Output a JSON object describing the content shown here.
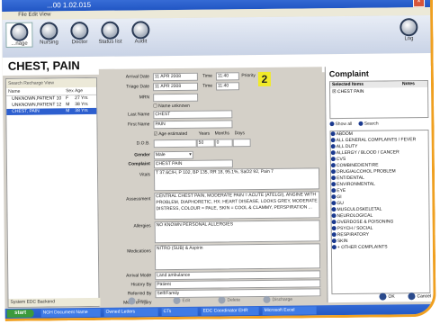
{
  "window": {
    "title": "...00 1.02.015"
  },
  "toolbar": {
    "buttons": [
      "...nage",
      "Nursing",
      "Doctor",
      "Status list",
      "Audit"
    ],
    "logout": "Log"
  },
  "page_title": "CHEST, PAIN",
  "patient_list": {
    "toolbar": "Search   Recharge   View",
    "headers": [
      "Name",
      "Sex",
      "Age"
    ],
    "rows": [
      {
        "name": "UNKNOWN,PATIENT 10",
        "sex": "F",
        "age": "27 Yrs"
      },
      {
        "name": "UNKNOWN,PATIENT 12",
        "sex": "M",
        "age": "38 Yrs"
      },
      {
        "name": "CHEST, PAIN",
        "sex": "M",
        "age": "38 Yrs"
      }
    ],
    "status": "System EDC Backend"
  },
  "form": {
    "arrival_date_label": "Arrival Date",
    "arrival_date": "11 APR 2008",
    "triage_date_label": "Triage Date",
    "triage_date": "11 APR 2008",
    "time_label": "Time",
    "time": "11:40",
    "time2_label": "Time",
    "time2": "11:40",
    "priority_label": "Priority",
    "priority": "2",
    "mrn_label": "MRN",
    "name_unknown": "Name unknown",
    "last_name_label": "Last Name",
    "last_name": "CHEST",
    "first_name_label": "First Name",
    "first_name": "PAIN",
    "age_estimated": "Age estimated",
    "years_label": "Years",
    "months_label": "Months",
    "days_label": "Days",
    "dob_label": "D.O.B.",
    "years": "50",
    "months": "0",
    "gender_label": "Gender",
    "gender": "Male",
    "complaint_label": "Complaint",
    "complaint": "CHEST PAIN",
    "vitals_label": "Vitals",
    "vitals": "T 37.6C/H, P 102, BP 135, RR 18, 95.1%, SaO2 92, Pain 7",
    "assessment_label": "Assessment",
    "assessment": "CENTRAL CHEST PAIN, MODERATE PAIN = ACUTE (ATELGI), ANGINE WITH PROBLEM, DIAPHORETIC, HX: HEART DISEASE, LOOKS GREY, MODERATE DISTRESS, COLOUR = PALE, SKIN = COOL & CLAMMY, PERSPIRATION ...",
    "allergies_label": "Allergies",
    "allergies": "NO KNOWN PERSONAL ALLERGIES",
    "medications_label": "Medications",
    "medications": "NITRO (SUB) & Aspirin",
    "arrival_mode_label": "Arrival Mode",
    "arrival_mode": "Land ambulance",
    "history_label": "History By",
    "history": "Patient",
    "referred_label": "Referred By",
    "referred": "Self/Family",
    "mech_label": "Mech of Injury",
    "mech": ""
  },
  "complaint_panel": {
    "title": "Complaint",
    "selected_header": "Selected Items",
    "notes_header": "Notes",
    "selected_item": "CHEST PAIN",
    "show_all": "Show all",
    "search": "Search",
    "items": [
      "ABDOM",
      "ALL GENERAL COMPLAINTS / FEVER",
      "ALL DUTY",
      "ALLERGY / BLOOD / CANCER",
      "CVS",
      "COMBINED/ENTIRE",
      "DRUG/ALCOHOL PROBLEM",
      "ENT/DENTAL",
      "ENVIRONMENTAL",
      "EYE",
      "GI",
      "GU",
      "MUSCULOSKELETAL",
      "NEUROLOGICAL",
      "OVERDOSE & POISONING",
      "PSYCH / SOCIAL",
      "RESPIRATORY",
      "SKIN",
      "+ OTHER COMPLAINTS"
    ]
  },
  "bottom_buttons": [
    "Save",
    "Edit",
    "Delete",
    "Discharge"
  ],
  "ok_label": "OK",
  "cancel_label": "Cancel",
  "taskbar": {
    "start": "start",
    "tasks": [
      "NGH Document Name",
      "Owned Letters",
      "CTs",
      "EDC Coordinator EHR",
      "Microsoft Excel"
    ]
  },
  "colors": {
    "accent": "#f0a020",
    "priority": "#f1ea2a",
    "selection": "#2d5fcf"
  }
}
